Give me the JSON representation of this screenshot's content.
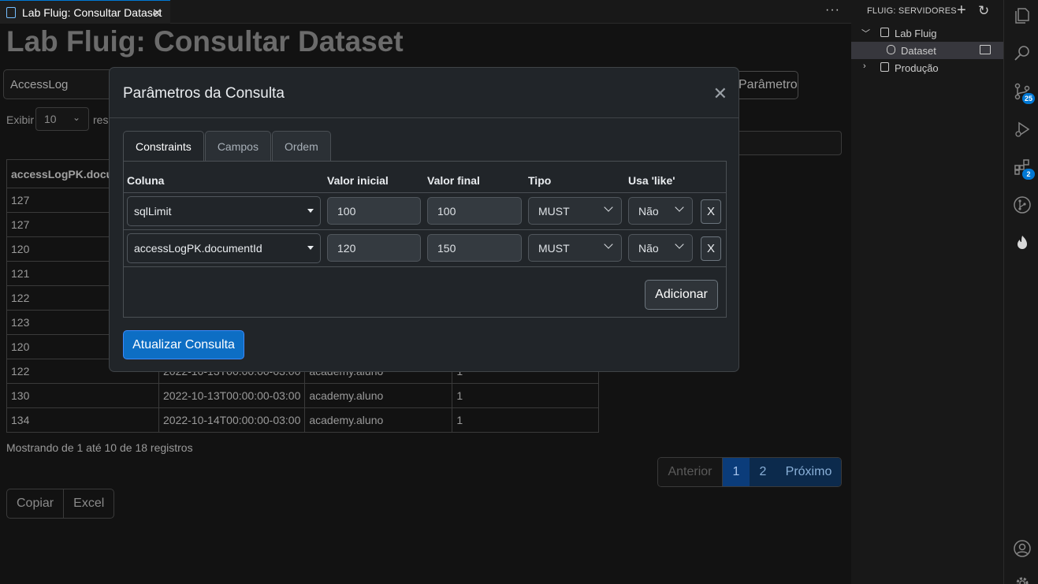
{
  "editor_tab": {
    "title": "Lab Fluig: Consultar Dataset",
    "close": "✕",
    "more": "···"
  },
  "page": {
    "title": "Lab Fluig: Consultar Dataset",
    "dataset_value": "AccessLog",
    "params_button": "Parâmetros",
    "exibir_label": "Exibir",
    "page_length": "10",
    "records_label_fragment": "res",
    "columns": [
      "accessLogPK.documentId"
    ],
    "rows_visible": [
      [
        "127"
      ],
      [
        "127"
      ],
      [
        "120"
      ],
      [
        "121"
      ],
      [
        "122"
      ],
      [
        "123"
      ],
      [
        "120"
      ],
      [
        "122",
        "2022-10-13T00:00:00-03:00",
        "academy.aluno",
        "1"
      ],
      [
        "130",
        "2022-10-13T00:00:00-03:00",
        "academy.aluno",
        "1"
      ],
      [
        "134",
        "2022-10-14T00:00:00-03:00",
        "academy.aluno",
        "1"
      ]
    ],
    "info": "Mostrando de 1 até 10 de 18 registros",
    "pager": {
      "prev": "Anterior",
      "page1": "1",
      "page2": "2",
      "next": "Próximo"
    },
    "export": {
      "copy": "Copiar",
      "excel": "Excel"
    }
  },
  "modal": {
    "title": "Parâmetros da Consulta",
    "close": "✕",
    "tabs": [
      "Constraints",
      "Campos",
      "Ordem"
    ],
    "headers": {
      "coluna": "Coluna",
      "valor_inicial": "Valor inicial",
      "valor_final": "Valor final",
      "tipo": "Tipo",
      "like": "Usa 'like'"
    },
    "constraints": [
      {
        "coluna": "sqlLimit",
        "inicial": "100",
        "final": "100",
        "tipo": "MUST",
        "like": "Não",
        "remove": "X"
      },
      {
        "coluna": "accessLogPK.documentId",
        "inicial": "120",
        "final": "150",
        "tipo": "MUST",
        "like": "Não",
        "remove": "X"
      }
    ],
    "add_button": "Adicionar",
    "update_button": "Atualizar Consulta"
  },
  "sidebar": {
    "title": "FLUIG: SERVIDORES",
    "tree": [
      {
        "label": "Lab Fluig",
        "expanded": true
      },
      {
        "label": "Dataset",
        "selected": true
      },
      {
        "label": "Produção",
        "expanded": false
      }
    ]
  },
  "activity": {
    "scm_badge": "25",
    "extensions_badge": "2"
  },
  "colors": {
    "accent": "#0078d4",
    "primary_button": "#0d6ec4",
    "modal_bg": "#212529"
  }
}
